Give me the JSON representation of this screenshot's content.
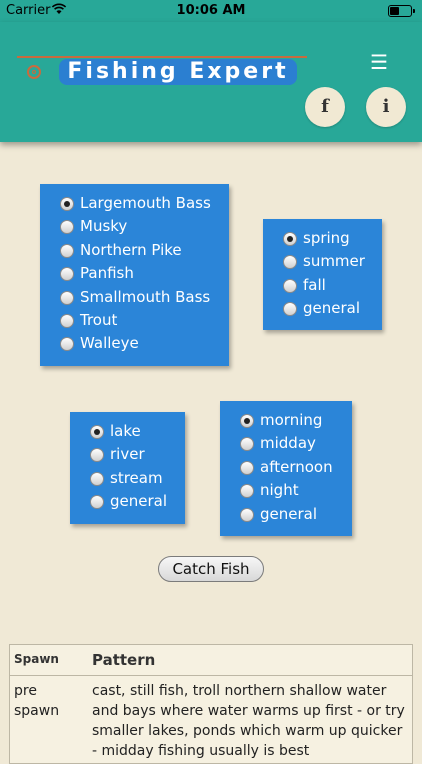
{
  "status_bar": {
    "carrier": "Carrier",
    "time": "10:06 AM"
  },
  "header": {
    "title": "Fishing Expert",
    "fb_label": "f",
    "info_label": "i"
  },
  "species": {
    "options": [
      "Largemouth Bass",
      "Musky",
      "Northern Pike",
      "Panfish",
      "Smallmouth Bass",
      "Trout",
      "Walleye"
    ],
    "selected": "Largemouth Bass"
  },
  "season": {
    "options": [
      "spring",
      "summer",
      "fall",
      "general"
    ],
    "selected": "spring"
  },
  "water": {
    "options": [
      "lake",
      "river",
      "stream",
      "general"
    ],
    "selected": "lake"
  },
  "time_of_day": {
    "options": [
      "morning",
      "midday",
      "afternoon",
      "night",
      "general"
    ],
    "selected": "morning"
  },
  "catch_button": "Catch Fish",
  "table": {
    "col_spawn": "Spawn",
    "col_pattern": "Pattern",
    "rows": [
      {
        "spawn": "pre spawn",
        "pattern": "cast, still fish, troll northern shallow water and bays where water warms up first - or try smaller lakes, ponds which warm up quicker - midday fishing usually is best"
      }
    ]
  },
  "colors": {
    "header": "#28a898",
    "panel": "#2b85d8",
    "title_bg": "#2b7fd1",
    "accent_line": "#c86b3e",
    "background": "#f0e9d6"
  }
}
